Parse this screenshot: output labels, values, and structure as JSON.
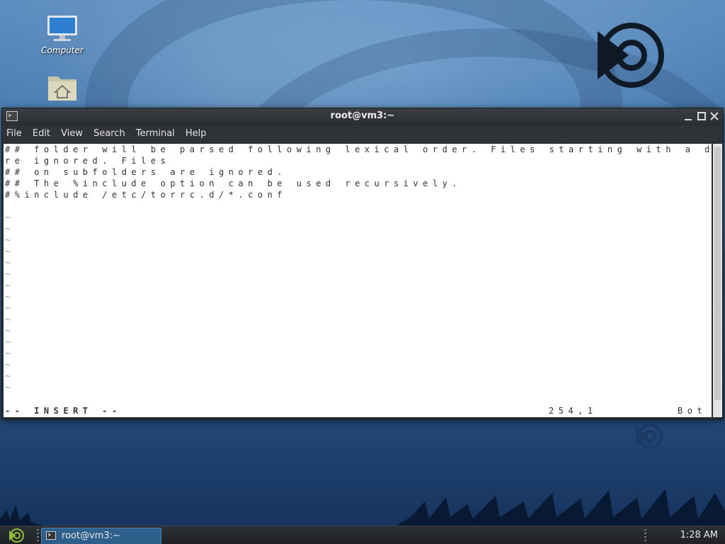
{
  "desktop": {
    "icons": [
      {
        "label": "Computer",
        "icon": "computer-icon"
      },
      {
        "label": "",
        "icon": "home-folder-icon"
      }
    ]
  },
  "window": {
    "title": "root@vm3:~",
    "menu": [
      "File",
      "Edit",
      "View",
      "Search",
      "Terminal",
      "Help"
    ]
  },
  "editor": {
    "lines": [
      "## folder will be parsed following lexical order. Files starting with a dot a",
      "re ignored. Files",
      "## on subfolders are ignored.",
      "## The %include option can be used recursively.",
      "#%include /etc/torrc.d/*.conf",
      ""
    ],
    "empty_marker": "~",
    "mode": "-- INSERT --",
    "position": "254,1",
    "scroll": "Bot"
  },
  "taskbar": {
    "task_label": "root@vm3:~",
    "clock": "1:28 AM"
  },
  "colors": {
    "terminal_bg": "#ffffff",
    "tilde": "#6f9fd6",
    "task_active": "#2e5f8a"
  }
}
